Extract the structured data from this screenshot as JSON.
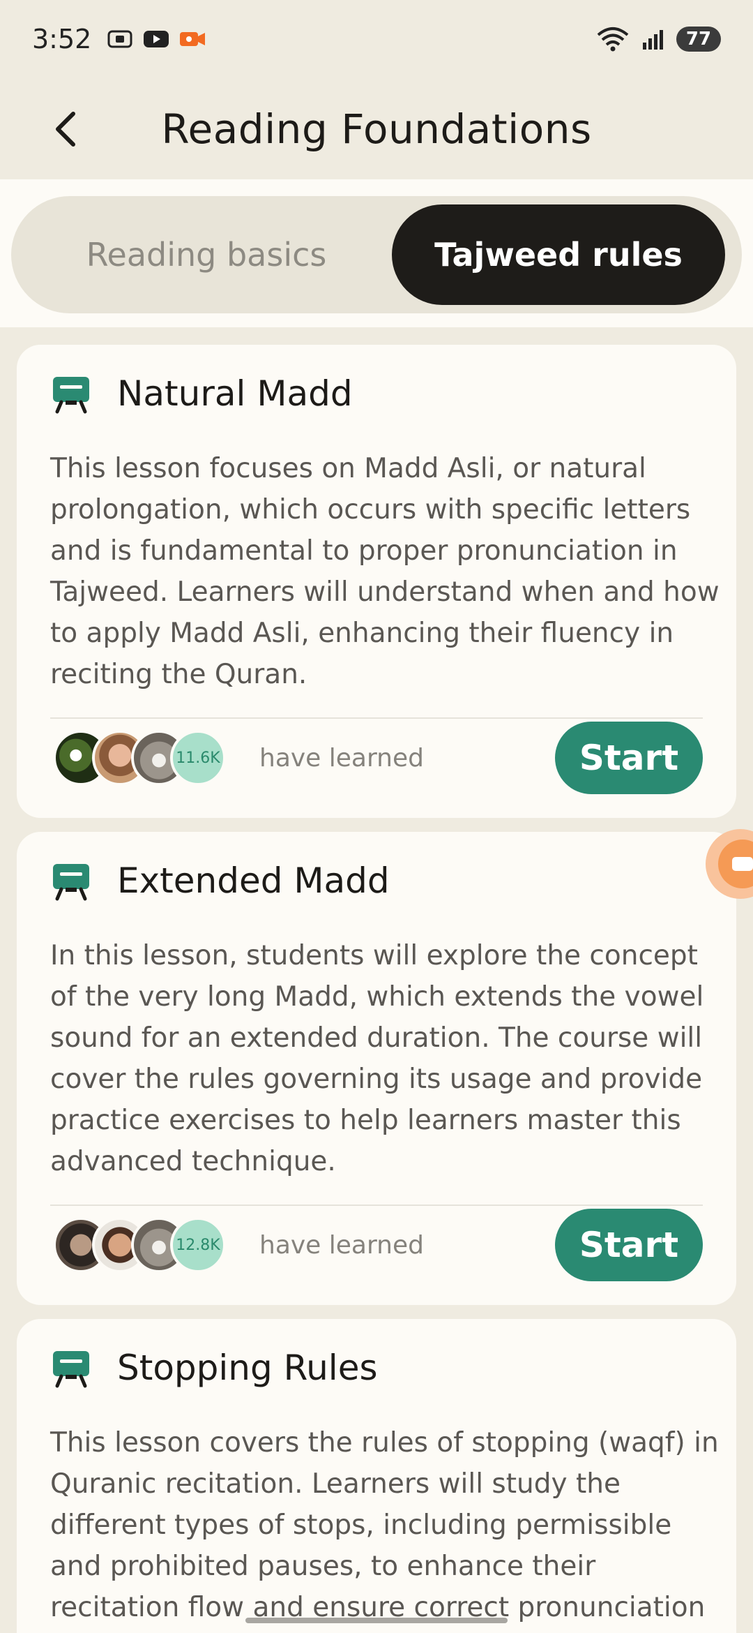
{
  "status_bar": {
    "time": "3:52",
    "battery": "77",
    "left_icons": [
      "screenshot-icon",
      "youtube-icon",
      "screen-record-icon"
    ],
    "right_icons": [
      "wifi-icon",
      "signal-icon"
    ]
  },
  "header": {
    "title": "Reading Foundations",
    "back_icon": "chevron-left-icon"
  },
  "tabs": [
    {
      "label": "Reading basics",
      "active": false
    },
    {
      "label": "Tajweed rules",
      "active": true
    }
  ],
  "lessons": [
    {
      "title": "Natural Madd",
      "description": "This lesson focuses on Madd Asli, or natural prolongation, which occurs with specific letters and is fundamental to proper pronunciation in Tajweed. Learners will understand when and how to apply Madd Asli, enhancing their fluency in reciting the Quran.",
      "learned_count": "11.6K",
      "learned_label": "have learned",
      "start_label": "Start"
    },
    {
      "title": "Extended Madd",
      "description": "In this lesson, students will explore the concept of the very long Madd, which extends the vowel sound for an extended duration. The course will cover the rules governing its usage and provide practice exercises to help learners master this advanced technique.",
      "learned_count": "12.8K",
      "learned_label": "have learned",
      "start_label": "Start"
    },
    {
      "title": "Stopping Rules",
      "description": "This lesson covers the rules of stopping (waqf) in Quranic recitation. Learners will study the different types of stops, including permissible and prohibited pauses, to enhance their recitation flow and ensure correct pronunciation and meaning."
    }
  ],
  "colors": {
    "accent": "#2a8a72",
    "tab_active_bg": "#1e1c19",
    "background": "#efebe0",
    "card": "#fdfbf6"
  }
}
